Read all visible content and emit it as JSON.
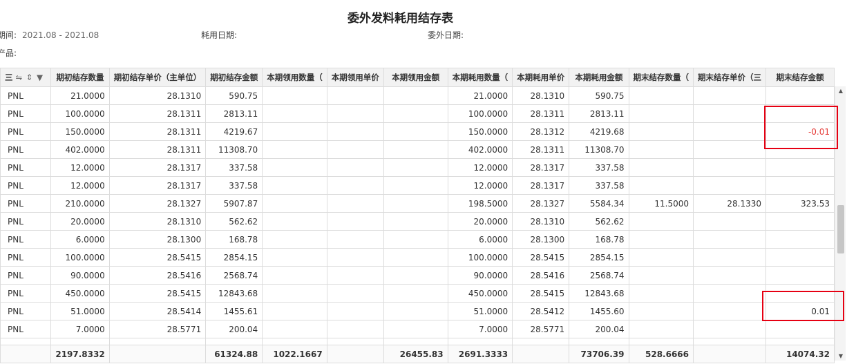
{
  "title": "委外发料耗用结存表",
  "filters": {
    "period_label": "期间:",
    "period_value": "2021.08 - 2021.08",
    "consume_date_label": "耗用日期:",
    "outsource_date_label": "委外日期:",
    "product_label": "产品:"
  },
  "header": {
    "first_col_partial": "三",
    "first_col_icons": "⇋ ⇕ ▼",
    "columns": [
      "期初结存数量",
      "期初结存单价（主单位）",
      "期初结存金额",
      "本期领用数量（",
      "本期领用单价",
      "本期领用金额",
      "本期耗用数量（",
      "本期耗用单价",
      "本期耗用金额",
      "期末结存数量（",
      "期末结存单价（三",
      "期末结存金额"
    ]
  },
  "rows": [
    {
      "unit": "PNL",
      "c1": "21.0000",
      "c2": "28.1310",
      "c3": "590.75",
      "c4": "",
      "c5": "",
      "c6": "",
      "c7": "21.0000",
      "c8": "28.1310",
      "c9": "590.75",
      "c10": "",
      "c11": "",
      "c12": ""
    },
    {
      "unit": "PNL",
      "c1": "100.0000",
      "c2": "28.1311",
      "c3": "2813.11",
      "c4": "",
      "c5": "",
      "c6": "",
      "c7": "100.0000",
      "c8": "28.1311",
      "c9": "2813.11",
      "c10": "",
      "c11": "",
      "c12": ""
    },
    {
      "unit": "PNL",
      "c1": "150.0000",
      "c2": "28.1311",
      "c3": "4219.67",
      "c4": "",
      "c5": "",
      "c6": "",
      "c7": "150.0000",
      "c8": "28.1312",
      "c9": "4219.68",
      "c10": "",
      "c11": "",
      "c12": "-0.01"
    },
    {
      "unit": "PNL",
      "c1": "402.0000",
      "c2": "28.1311",
      "c3": "11308.70",
      "c4": "",
      "c5": "",
      "c6": "",
      "c7": "402.0000",
      "c8": "28.1311",
      "c9": "11308.70",
      "c10": "",
      "c11": "",
      "c12": ""
    },
    {
      "unit": "PNL",
      "c1": "12.0000",
      "c2": "28.1317",
      "c3": "337.58",
      "c4": "",
      "c5": "",
      "c6": "",
      "c7": "12.0000",
      "c8": "28.1317",
      "c9": "337.58",
      "c10": "",
      "c11": "",
      "c12": ""
    },
    {
      "unit": "PNL",
      "c1": "12.0000",
      "c2": "28.1317",
      "c3": "337.58",
      "c4": "",
      "c5": "",
      "c6": "",
      "c7": "12.0000",
      "c8": "28.1317",
      "c9": "337.58",
      "c10": "",
      "c11": "",
      "c12": ""
    },
    {
      "unit": "PNL",
      "c1": "210.0000",
      "c2": "28.1327",
      "c3": "5907.87",
      "c4": "",
      "c5": "",
      "c6": "",
      "c7": "198.5000",
      "c8": "28.1327",
      "c9": "5584.34",
      "c10": "11.5000",
      "c11": "28.1330",
      "c12": "323.53"
    },
    {
      "unit": "PNL",
      "c1": "20.0000",
      "c2": "28.1310",
      "c3": "562.62",
      "c4": "",
      "c5": "",
      "c6": "",
      "c7": "20.0000",
      "c8": "28.1310",
      "c9": "562.62",
      "c10": "",
      "c11": "",
      "c12": ""
    },
    {
      "unit": "PNL",
      "c1": "6.0000",
      "c2": "28.1300",
      "c3": "168.78",
      "c4": "",
      "c5": "",
      "c6": "",
      "c7": "6.0000",
      "c8": "28.1300",
      "c9": "168.78",
      "c10": "",
      "c11": "",
      "c12": ""
    },
    {
      "unit": "PNL",
      "c1": "100.0000",
      "c2": "28.5415",
      "c3": "2854.15",
      "c4": "",
      "c5": "",
      "c6": "",
      "c7": "100.0000",
      "c8": "28.5415",
      "c9": "2854.15",
      "c10": "",
      "c11": "",
      "c12": ""
    },
    {
      "unit": "PNL",
      "c1": "90.0000",
      "c2": "28.5416",
      "c3": "2568.74",
      "c4": "",
      "c5": "",
      "c6": "",
      "c7": "90.0000",
      "c8": "28.5416",
      "c9": "2568.74",
      "c10": "",
      "c11": "",
      "c12": ""
    },
    {
      "unit": "PNL",
      "c1": "450.0000",
      "c2": "28.5415",
      "c3": "12843.68",
      "c4": "",
      "c5": "",
      "c6": "",
      "c7": "450.0000",
      "c8": "28.5415",
      "c9": "12843.68",
      "c10": "",
      "c11": "",
      "c12": ""
    },
    {
      "unit": "PNL",
      "c1": "51.0000",
      "c2": "28.5414",
      "c3": "1455.61",
      "c4": "",
      "c5": "",
      "c6": "",
      "c7": "51.0000",
      "c8": "28.5412",
      "c9": "1455.60",
      "c10": "",
      "c11": "",
      "c12": "0.01"
    },
    {
      "unit": "PNL",
      "c1": "7.0000",
      "c2": "28.5771",
      "c3": "200.04",
      "c4": "",
      "c5": "",
      "c6": "",
      "c7": "7.0000",
      "c8": "28.5771",
      "c9": "200.04",
      "c10": "",
      "c11": "",
      "c12": ""
    }
  ],
  "totals": {
    "unit": "",
    "c1": "2197.8332",
    "c2": "",
    "c3": "61324.88",
    "c4": "1022.1667",
    "c5": "",
    "c6": "26455.83",
    "c7": "2691.3333",
    "c8": "",
    "c9": "73706.39",
    "c10": "528.6666",
    "c11": "",
    "c12": "14074.32"
  },
  "colors": {
    "highlight": "#e60012",
    "negative": "#e53935"
  }
}
